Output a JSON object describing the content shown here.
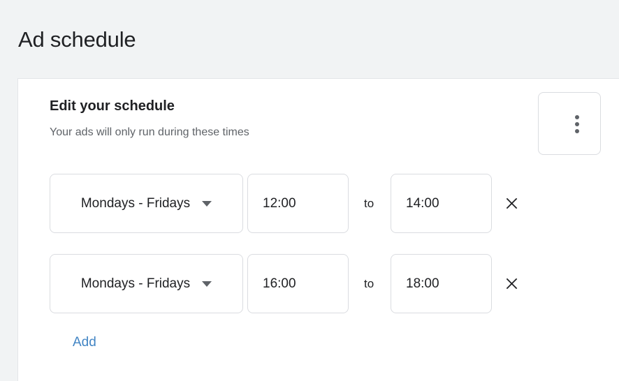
{
  "page": {
    "title": "Ad schedule"
  },
  "card": {
    "title": "Edit your schedule",
    "subtitle": "Your ads will only run during these times",
    "overflow_menu_label": "More options",
    "add_label": "Add",
    "to_label": "to",
    "rows": [
      {
        "days": "Mondays - Fridays",
        "start_time": "12:00",
        "end_time": "14:00",
        "remove_label": "×"
      },
      {
        "days": "Mondays - Fridays",
        "start_time": "16:00",
        "end_time": "18:00",
        "remove_label": "×"
      }
    ]
  },
  "colors": {
    "page_background": "#f1f3f4",
    "card_background": "#ffffff",
    "text_primary": "#202124",
    "text_secondary": "#5f6368",
    "border": "#dadce0",
    "link_blue": "#4285c4"
  }
}
